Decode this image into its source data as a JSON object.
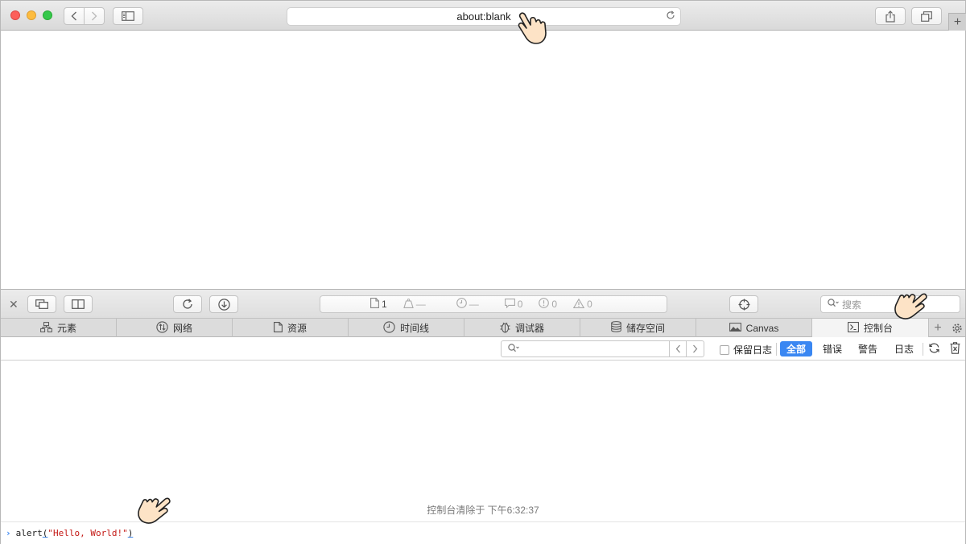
{
  "browser": {
    "address": "about:blank",
    "icons": [
      "back-icon",
      "forward-icon",
      "sidebar-icon",
      "share-icon",
      "tabs-icon",
      "reload-icon",
      "new-tab-icon"
    ]
  },
  "devtools": {
    "status": {
      "resources": "1",
      "size": "—",
      "time": "—",
      "logs": "0",
      "errors": "0",
      "warnings": "0"
    },
    "search_placeholder": "搜索",
    "tabs": [
      {
        "label": "元素",
        "icon": "elements-icon"
      },
      {
        "label": "网络",
        "icon": "network-icon"
      },
      {
        "label": "资源",
        "icon": "resources-icon"
      },
      {
        "label": "时间线",
        "icon": "timeline-icon"
      },
      {
        "label": "调试器",
        "icon": "debugger-icon"
      },
      {
        "label": "储存空间",
        "icon": "storage-icon"
      },
      {
        "label": "Canvas",
        "icon": "canvas-icon"
      },
      {
        "label": "控制台",
        "icon": "console-icon",
        "active": true
      }
    ],
    "console": {
      "preserve_log_label": "保留日志",
      "preserve_log_checked": false,
      "filters": [
        "全部",
        "错误",
        "警告",
        "日志"
      ],
      "active_filter": "全部",
      "cleared_message": "控制台清除于 下午6:32:37",
      "input": {
        "fn": "alert",
        "arg": "\"Hello, World!\""
      }
    }
  }
}
